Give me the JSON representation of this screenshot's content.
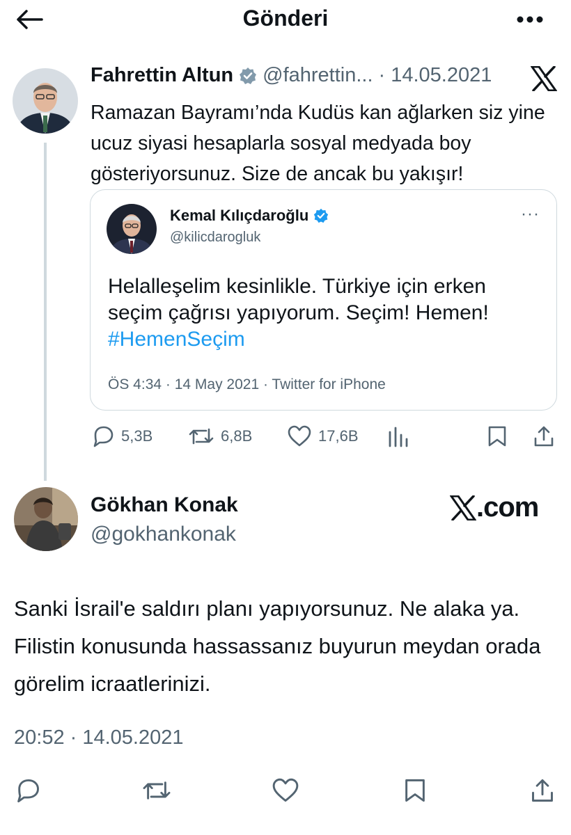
{
  "header": {
    "title": "Gönderi",
    "back_icon": "arrow-left-icon",
    "more_icon": "more-horizontal-icon"
  },
  "tweet": {
    "author_name": "Fahrettin Altun",
    "handle": "@fahrettin...",
    "separator": "·",
    "date": "14.05.2021",
    "text": "Ramazan Bayramı’nda Kudüs kan ağlarken siz yine ucuz siyasi hesaplarla sosyal medyada boy gösteriyorsunuz. Size de ancak bu yakışır!",
    "quoted": {
      "author_name": "Kemal Kılıçdaroğlu",
      "handle": "@kilicdarogluk",
      "more": "···",
      "text": "Helalleşelim kesinlikle. Türkiye için erken seçim çağrısı yapıyorum. Seçim! Hemen!",
      "hashtag": "#HemenSeçim",
      "footer": "ÖS 4:34 · 14 May 2021 · Twitter for iPhone"
    },
    "actions": {
      "replies": "5,3B",
      "reposts": "6,8B",
      "likes": "17,6B"
    }
  },
  "reply": {
    "author_name": "Gökhan Konak",
    "handle": "@gokhankonak",
    "watermark": ".com",
    "text": "Sanki İsrail'e saldırı planı yapıyorsunuz. Ne alaka ya. Filistin konusunda hassassanız buyurun meydan orada görelim icraatlerinizi.",
    "time": "20:52 · 14.05.2021"
  },
  "colors": {
    "text": "#0f1419",
    "muted": "#536471",
    "link": "#1d9bf0",
    "verified": "#1d9bf0",
    "border": "#cfd9de"
  }
}
